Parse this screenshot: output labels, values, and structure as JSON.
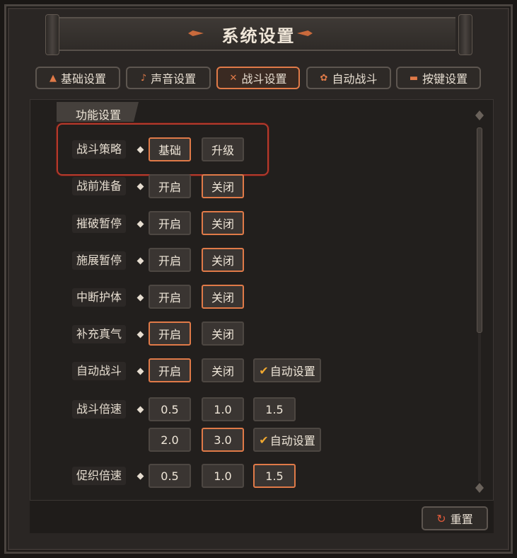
{
  "window": {
    "title": "系统设置"
  },
  "tabs": [
    {
      "label": "基础设置",
      "icon": "flask-icon"
    },
    {
      "label": "声音设置",
      "icon": "music-icon"
    },
    {
      "label": "战斗设置",
      "icon": "crossed-swords-icon"
    },
    {
      "label": "自动战斗",
      "icon": "flower-icon"
    },
    {
      "label": "按键设置",
      "icon": "keycap-icon"
    }
  ],
  "active_tab": "战斗设置",
  "section": {
    "title": "功能设置"
  },
  "rows": [
    {
      "label": "战斗策略",
      "options": [
        "基础",
        "升级"
      ]
    },
    {
      "label": "战前准备",
      "options": [
        "开启",
        "关闭"
      ]
    },
    {
      "label": "摧破暂停",
      "options": [
        "开启",
        "关闭"
      ]
    },
    {
      "label": "施展暂停",
      "options": [
        "开启",
        "关闭"
      ]
    },
    {
      "label": "中断护体",
      "options": [
        "开启",
        "关闭"
      ]
    },
    {
      "label": "补充真气",
      "options": [
        "开启",
        "关闭"
      ]
    },
    {
      "label": "自动战斗",
      "options": [
        "开启",
        "关闭"
      ],
      "extra": "自动设置"
    },
    {
      "label": "战斗倍速",
      "options": [
        "0.5",
        "1.0",
        "1.5",
        "2.0",
        "3.0"
      ],
      "extra": "自动设置"
    },
    {
      "label": "促织倍速",
      "options": [
        "0.5",
        "1.0",
        "1.5"
      ]
    }
  ],
  "footer": {
    "reset_label": "重置"
  },
  "colors": {
    "accent": "#e07a48",
    "highlight": "#b53a2c",
    "check": "#f0a830"
  }
}
